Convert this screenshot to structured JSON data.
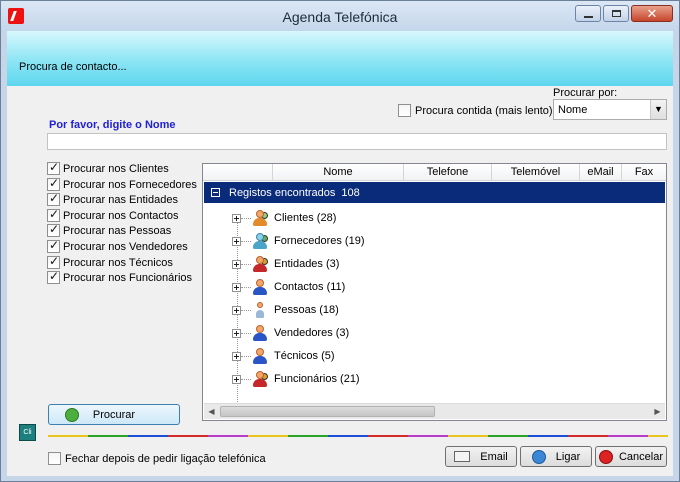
{
  "window": {
    "title": "Agenda Telefónica",
    "controls": {
      "minimize": "",
      "maximize": "",
      "close": "✕"
    }
  },
  "header": {
    "text": "Procura de contacto..."
  },
  "search_contained": {
    "label": "Procura contida (mais lento)",
    "checked": false
  },
  "search_by": {
    "label": "Procurar por:",
    "value": "Nome"
  },
  "search": {
    "prompt": "Por favor, digite o Nome",
    "value": "",
    "placeholder": ""
  },
  "filters": [
    {
      "label": "Procurar nos Clientes",
      "checked": true
    },
    {
      "label": "Procurar nos Fornecedores",
      "checked": true
    },
    {
      "label": "Procurar nas Entidades",
      "checked": true
    },
    {
      "label": "Procurar nos Contactos",
      "checked": true
    },
    {
      "label": "Procurar nas Pessoas",
      "checked": true
    },
    {
      "label": "Procurar nos Vendedores",
      "checked": true
    },
    {
      "label": "Procurar nos Técnicos",
      "checked": true
    },
    {
      "label": "Procurar nos Funcionários",
      "checked": true
    }
  ],
  "grid": {
    "columns": [
      "",
      "Nome",
      "Telefone",
      "Telemóvel",
      "eMail",
      "Fax"
    ],
    "group": {
      "label": "Registos encontrados",
      "count": "108"
    },
    "items": [
      {
        "label": "Clientes (28)",
        "icon": "clients-icon"
      },
      {
        "label": "Fornecedores (19)",
        "icon": "suppliers-icon"
      },
      {
        "label": "Entidades (3)",
        "icon": "entities-icon"
      },
      {
        "label": "Contactos (11)",
        "icon": "contacts-icon"
      },
      {
        "label": "Pessoas (18)",
        "icon": "people-icon"
      },
      {
        "label": "Vendedores (3)",
        "icon": "sellers-icon"
      },
      {
        "label": "Técnicos (5)",
        "icon": "technicians-icon"
      },
      {
        "label": "Funcionários (21)",
        "icon": "employees-icon"
      }
    ]
  },
  "buttons": {
    "search": "Procurar",
    "email": "Email",
    "call": "Ligar",
    "cancel": "Cancelar"
  },
  "close_after_call": {
    "label": "Fechar depois de pedir ligação telefónica",
    "checked": false
  },
  "logo_text": "Cli"
}
